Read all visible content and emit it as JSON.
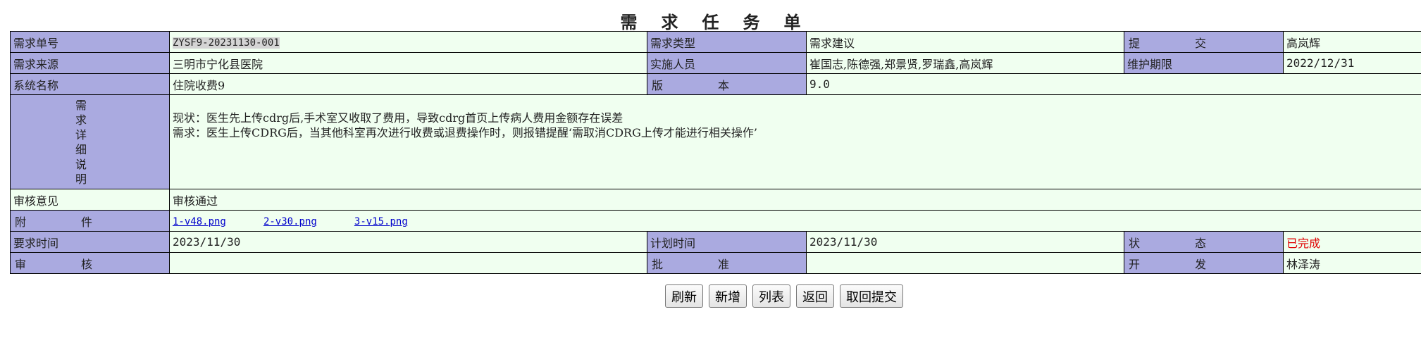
{
  "title": [
    "需",
    "求",
    "任",
    "务",
    "单"
  ],
  "row1": {
    "label1": "需求单号",
    "value1": "ZYSF9-20231130-001",
    "label2": "需求类型",
    "value2": "需求建议",
    "label3": [
      "提",
      "交"
    ],
    "value3": "高岚辉"
  },
  "row2": {
    "label1": "需求来源",
    "value1": "三明市宁化县医院",
    "label2": "实施人员",
    "value2": "崔国志,陈德强,郑景贤,罗瑞鑫,高岚辉",
    "label3": "维护期限",
    "value3": "2022/12/31"
  },
  "row3": {
    "label1": "系统名称",
    "value1": "住院收费9",
    "label2": [
      "版",
      "本"
    ],
    "value2": "9.0"
  },
  "detail": {
    "label": [
      "需",
      "求",
      "详",
      "细",
      "说",
      "明"
    ],
    "line1": "现状：医生先上传cdrg后,手术室又收取了费用，导致cdrg首页上传病人费用金额存在误差",
    "line2": "需求：医生上传CDRG后，当其他科室再次进行收费或退费操作时，则报错提醒‘需取消CDRG上传才能进行相关操作’"
  },
  "review_opinion": {
    "label": "审核意见",
    "value": "审核通过"
  },
  "attachments": {
    "label": [
      "附",
      "件"
    ],
    "files": [
      "1-v48.png",
      "2-v30.png",
      "3-v15.png"
    ]
  },
  "row7": {
    "label1": "要求时间",
    "value1": "2023/11/30",
    "label2": "计划时间",
    "value2": "2023/11/30",
    "label3": [
      "状",
      "态"
    ],
    "value3": "已完成",
    "status_color": "#e00000"
  },
  "row8": {
    "label1": [
      "审",
      "核"
    ],
    "value1": "",
    "label2": [
      "批",
      "准"
    ],
    "value2": "",
    "label3": [
      "开",
      "发"
    ],
    "value3": "林泽涛"
  },
  "buttons": {
    "refresh": "刷新",
    "add": "新增",
    "list": "列表",
    "back": "返回",
    "withdraw": "取回提交"
  },
  "colors": {
    "label_bg": "#aaaae0",
    "value_bg": "#f0fff0"
  }
}
